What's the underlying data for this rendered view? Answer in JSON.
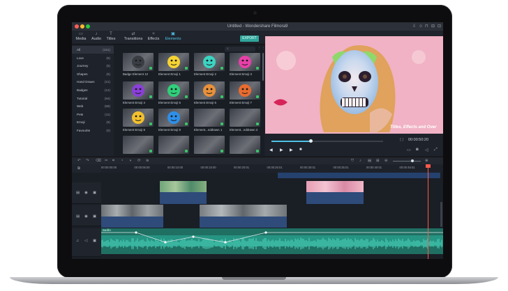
{
  "window": {
    "title": "Untitled - Wondershare Filmora9"
  },
  "titlebar_icons": [
    "download-icon",
    "user-icon",
    "cart-icon",
    "minimize-icon",
    "maximize-icon"
  ],
  "tabs": [
    {
      "label": "Media",
      "icon": "folder-icon",
      "active": false
    },
    {
      "label": "Audio",
      "icon": "music-note-icon",
      "active": false
    },
    {
      "label": "Titles",
      "icon": "text-icon",
      "active": false
    },
    {
      "label": "Transitions",
      "icon": "transition-icon",
      "active": false
    },
    {
      "label": "Effects",
      "icon": "effects-icon",
      "active": false
    },
    {
      "label": "Elements",
      "icon": "elements-icon",
      "active": true
    }
  ],
  "toolbar": {
    "export_label": "EXPORT"
  },
  "categories": [
    {
      "name": "All",
      "count": "(151)"
    },
    {
      "name": "Love",
      "count": "(6)"
    },
    {
      "name": "Journey",
      "count": "(5)"
    },
    {
      "name": "Shapes",
      "count": "(6)"
    },
    {
      "name": "Hand Drawn",
      "count": "(21)"
    },
    {
      "name": "Badges",
      "count": "(12)"
    },
    {
      "name": "Tutorial",
      "count": "(64)"
    },
    {
      "name": "Web",
      "count": "(58)"
    },
    {
      "name": "Pets",
      "count": "(11)"
    },
    {
      "name": "Emoji",
      "count": "(9)"
    },
    {
      "name": "Favourite",
      "count": "(0)"
    }
  ],
  "elements": [
    {
      "label": "Badge Element 12",
      "emoji": "badge",
      "color": "#3a3e44"
    },
    {
      "label": "Element Emoji 1",
      "emoji": "smile",
      "color": "#f5d333"
    },
    {
      "label": "Element Emoji 2",
      "emoji": "scared",
      "color": "#3bd4c2"
    },
    {
      "label": "Element Emoji 3",
      "emoji": "poop",
      "color": "#e83fa8"
    },
    {
      "label": "Element Emoji 4",
      "emoji": "angry",
      "color": "#8a3fd8"
    },
    {
      "label": "Element Emoji 5",
      "emoji": "sick",
      "color": "#2fcf7a"
    },
    {
      "label": "Element Emoji 6",
      "emoji": "shocked",
      "color": "#e8903a"
    },
    {
      "label": "Element Emoji 7",
      "emoji": "mad",
      "color": "#e86b2f"
    },
    {
      "label": "Element Emoji 8",
      "emoji": "love",
      "color": "#f3c12e"
    },
    {
      "label": "Element Emoji 9",
      "emoji": "cool",
      "color": "#2e8fe8"
    },
    {
      "label": "Element...nddrawn 1",
      "emoji": "",
      "color": ""
    },
    {
      "label": "Element...nddrawn 2",
      "emoji": "",
      "color": ""
    },
    {
      "label": "",
      "emoji": "",
      "color": ""
    },
    {
      "label": "",
      "emoji": "",
      "color": ""
    },
    {
      "label": "",
      "emoji": "",
      "color": ""
    },
    {
      "label": "",
      "emoji": "",
      "color": ""
    }
  ],
  "preview": {
    "overlay_text": "Titles, Effects and Over",
    "timecode": "00:00:50:20",
    "progress": 0.34
  },
  "controls": [
    "prev-frame-icon",
    "play-icon",
    "next-frame-icon",
    "stop-icon"
  ],
  "ruler": [
    "00:00:00:00",
    "00:00:05:00",
    "00:00:10:00",
    "00:00:15:00",
    "00:00:20:01",
    "00:00:25:01",
    "00:00:30:01",
    "00:00:35:01",
    "00:00:40:01",
    "00:00:45:01"
  ],
  "audio": {
    "label": "audio"
  },
  "colors": {
    "accent": "#4fc3e8",
    "export": "#2fa59b",
    "playhead": "#ff5a4a",
    "audio_clip": "#1f6f62",
    "video_clip_bar": "#2e4b7a"
  }
}
